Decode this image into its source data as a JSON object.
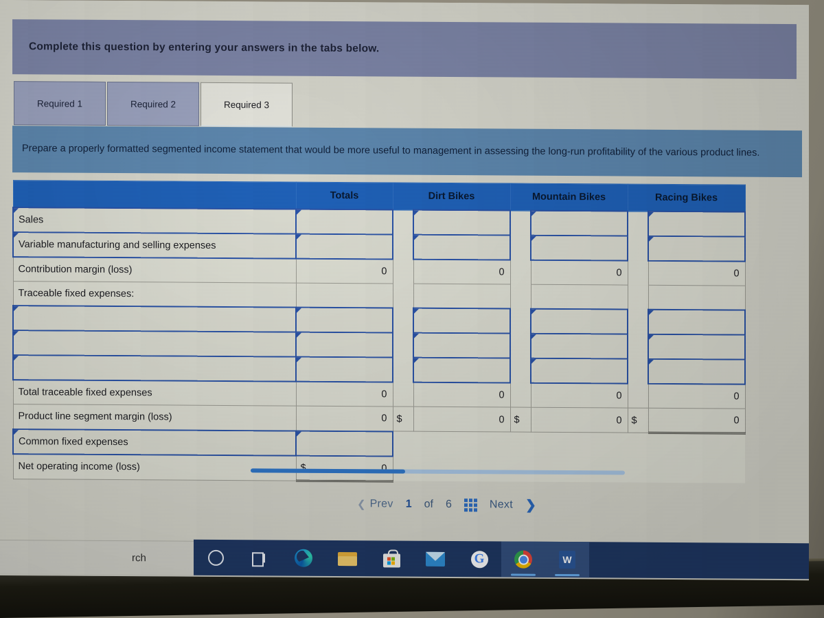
{
  "banner": {
    "text": "Complete this question by entering your answers in the tabs below."
  },
  "tabs": [
    {
      "label": "Required 1",
      "active": false
    },
    {
      "label": "Required 2",
      "active": false
    },
    {
      "label": "Required 3",
      "active": true
    }
  ],
  "instruction": {
    "text": "Prepare a properly formatted segmented income statement that would be more useful to management in assessing the long-run profitability of the various product lines."
  },
  "table": {
    "headers": [
      "",
      "Totals",
      "Dirt Bikes",
      "Mountain Bikes",
      "Racing Bikes"
    ],
    "rows": [
      {
        "label": "Sales",
        "totals": "",
        "dirt": "",
        "mountain": "",
        "racing": "",
        "editable": true
      },
      {
        "label": "Variable manufacturing and selling expenses",
        "totals": "",
        "dirt": "",
        "mountain": "",
        "racing": "",
        "editable": true
      },
      {
        "label": "Contribution margin (loss)",
        "totals": "0",
        "dirt": "0",
        "mountain": "0",
        "racing": "0",
        "editable": false
      },
      {
        "label": "Traceable fixed expenses:",
        "totals": "",
        "dirt": "",
        "mountain": "",
        "racing": "",
        "editable": false
      },
      {
        "label": "",
        "totals": "",
        "dirt": "",
        "mountain": "",
        "racing": "",
        "editable": true
      },
      {
        "label": "",
        "totals": "",
        "dirt": "",
        "mountain": "",
        "racing": "",
        "editable": true
      },
      {
        "label": "",
        "totals": "",
        "dirt": "",
        "mountain": "",
        "racing": "",
        "editable": true
      },
      {
        "label": "Total traceable fixed expenses",
        "totals": "0",
        "dirt": "0",
        "mountain": "0",
        "racing": "0",
        "editable": false
      },
      {
        "label": "Product line segment margin (loss)",
        "totals": "0",
        "dirt": "0",
        "mountain": "0",
        "racing": "0",
        "sign_totals": "",
        "sign_dirt": "$",
        "sign_mountain": "$",
        "sign_racing": "$",
        "editable": false
      },
      {
        "label": "Common fixed expenses",
        "totals": "",
        "dirt": "",
        "mountain": "",
        "racing": "",
        "editable": true
      },
      {
        "label": "Net operating income (loss)",
        "totals": "0",
        "sign_totals": "$",
        "dirt": "",
        "mountain": "",
        "racing": "",
        "editable": false
      }
    ]
  },
  "pager": {
    "prev_label": "Prev",
    "current_page": "1",
    "of_label": "of",
    "total_pages": "6",
    "next_label": "Next"
  },
  "taskbar": {
    "search_text": "rch",
    "items": [
      {
        "icon": "cortana-icon",
        "name": "cortana"
      },
      {
        "icon": "task-view-icon",
        "name": "task-view"
      },
      {
        "icon": "edge-icon",
        "name": "microsoft-edge"
      },
      {
        "icon": "file-explorer-icon",
        "name": "file-explorer"
      },
      {
        "icon": "microsoft-store-icon",
        "name": "microsoft-store"
      },
      {
        "icon": "mail-icon",
        "name": "mail"
      },
      {
        "icon": "google-icon",
        "name": "google"
      },
      {
        "icon": "chrome-icon",
        "name": "google-chrome"
      },
      {
        "icon": "word-icon",
        "name": "microsoft-word"
      }
    ]
  },
  "colors": {
    "banner_bg": "#7c84a6",
    "instruction_bg": "#5d87ae",
    "table_header_bg": "#1f61b8",
    "input_border": "#2a53a8",
    "scrollbar_thumb": "#2f76c9",
    "taskbar_bg": "#1f3864"
  }
}
